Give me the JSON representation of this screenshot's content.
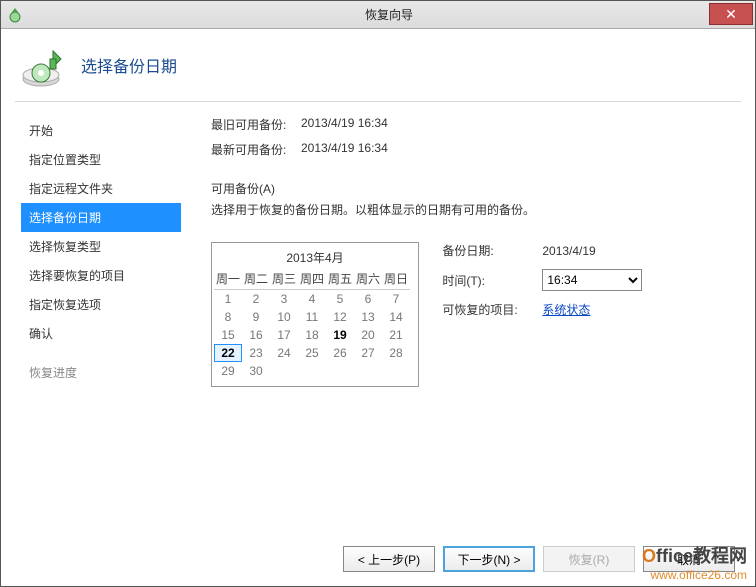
{
  "window": {
    "title": "恢复向导"
  },
  "header": {
    "title": "选择备份日期"
  },
  "nav": {
    "items": [
      {
        "label": "开始"
      },
      {
        "label": "指定位置类型"
      },
      {
        "label": "指定远程文件夹"
      },
      {
        "label": "选择备份日期"
      },
      {
        "label": "选择恢复类型"
      },
      {
        "label": "选择要恢复的项目"
      },
      {
        "label": "指定恢复选项"
      },
      {
        "label": "确认"
      },
      {
        "label": "恢复进度"
      }
    ],
    "selectedIndex": 3
  },
  "info": {
    "oldest_label": "最旧可用备份:",
    "oldest_value": "2013/4/19 16:34",
    "newest_label": "最新可用备份:",
    "newest_value": "2013/4/19 16:34",
    "available_label": "可用备份(A)",
    "available_desc": "选择用于恢复的备份日期。以粗体显示的日期有可用的备份。"
  },
  "calendar": {
    "title": "2013年4月",
    "weekdays": [
      "周一",
      "周二",
      "周三",
      "周四",
      "周五",
      "周六",
      "周日"
    ],
    "days": [
      {
        "n": "1"
      },
      {
        "n": "2"
      },
      {
        "n": "3"
      },
      {
        "n": "4"
      },
      {
        "n": "5"
      },
      {
        "n": "6"
      },
      {
        "n": "7"
      },
      {
        "n": "8"
      },
      {
        "n": "9"
      },
      {
        "n": "10"
      },
      {
        "n": "11"
      },
      {
        "n": "12"
      },
      {
        "n": "13"
      },
      {
        "n": "14"
      },
      {
        "n": "15"
      },
      {
        "n": "16"
      },
      {
        "n": "17"
      },
      {
        "n": "18"
      },
      {
        "n": "19",
        "bold": true
      },
      {
        "n": "20"
      },
      {
        "n": "21"
      },
      {
        "n": "22",
        "sel": true
      },
      {
        "n": "23"
      },
      {
        "n": "24"
      },
      {
        "n": "25"
      },
      {
        "n": "26"
      },
      {
        "n": "27"
      },
      {
        "n": "28"
      },
      {
        "n": "29"
      },
      {
        "n": "30"
      }
    ]
  },
  "details": {
    "date_label": "备份日期:",
    "date_value": "2013/4/19",
    "time_label": "时间(T):",
    "time_value": "16:34",
    "items_label": "可恢复的项目:",
    "items_link": "系统状态"
  },
  "buttons": {
    "prev": "< 上一步(P)",
    "next": "下一步(N) >",
    "recover": "恢复(R)",
    "cancel": "取消"
  },
  "watermark": {
    "brand_left": "O",
    "brand_right": "ffice教程网",
    "url": "www.office26.com"
  }
}
